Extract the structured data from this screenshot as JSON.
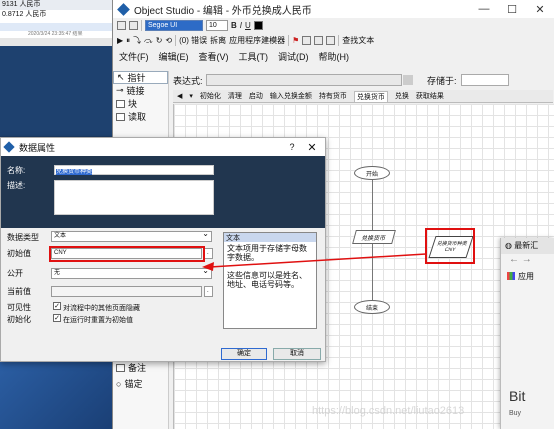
{
  "bg_app": {
    "row1": "9131 人民币",
    "row2": "0.8712 人民币",
    "row3": "2020/3/24 23:35:47 结果"
  },
  "window": {
    "title": "Object Studio - 编辑 - 外币兑换成人民币",
    "min": "—",
    "max": "☐",
    "close": "✕"
  },
  "toolbar1": {
    "font": "Segoe UI",
    "size": "10",
    "bold": "B",
    "italic": "I",
    "underline": "U"
  },
  "toolbar2": {
    "error_label": "(0) 错误",
    "detach_label": "拆离",
    "app_modeler_label": "应用程序建模器",
    "find_text_label": "查找文本"
  },
  "menu": [
    "文件(F)",
    "编辑(E)",
    "查看(V)",
    "工具(T)",
    "调试(D)",
    "帮助(H)"
  ],
  "tools": [
    "指针",
    "链接",
    "块",
    "读取"
  ],
  "tools_bottom": [
    "备注",
    "锚定"
  ],
  "expr": {
    "label": "表达式:",
    "store_label": "存储于:"
  },
  "page_tabs": [
    "初始化",
    "清理",
    "启动",
    "输入兑换金额",
    "持有货币",
    "兑换货币",
    "兑换",
    "获取结果"
  ],
  "page_tabs_active": 5,
  "flow": {
    "start": "开始",
    "exchange": "兑换货币",
    "end": "结束",
    "data_item": "兑换货币种类\nCNY"
  },
  "dialog": {
    "title": "数据属性",
    "help_q": "?",
    "close": "✕",
    "name_label": "名称:",
    "name_value": "兑换货币种类",
    "desc_label": "描述:",
    "type_label": "数据类型",
    "type_value": "文本",
    "init_label": "初始值",
    "init_value": "CNY",
    "exposure_label": "公开",
    "exposure_value": "无",
    "current_label": "当前值",
    "visibility_label": "可见性",
    "visibility_check": "对流程中的其他页面隐藏",
    "initialize_label": "初始化",
    "initialize_check": "在运行时重置为初始值",
    "help_head": "文本",
    "help_text": "文本项用于存储字母数字数据。\n\n这些信息可以是姓名、地址、电话号码等。",
    "ok": "确定",
    "cancel": "取消"
  },
  "browser": {
    "tab": "最新汇",
    "nav": "←  →",
    "apps": "应用",
    "card_title": "Bit",
    "card_sub": "Buy"
  },
  "watermark": "https://blog.csdn.net/liutao2613"
}
